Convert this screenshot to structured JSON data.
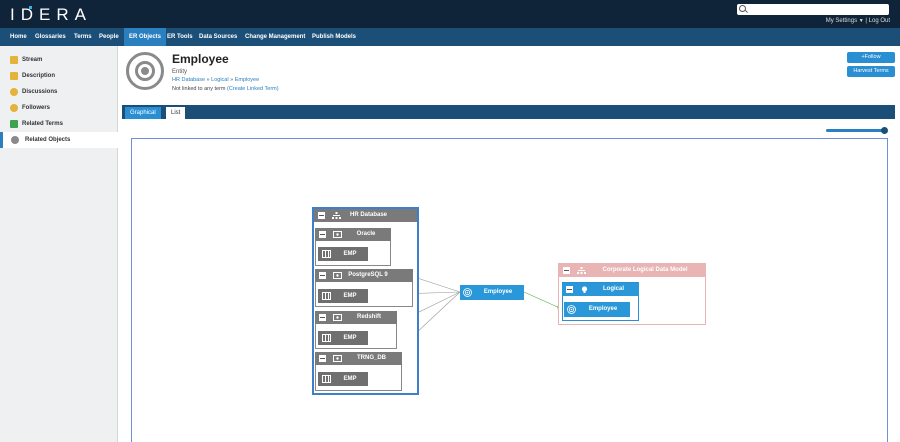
{
  "app": {
    "logo": "IDERA",
    "search_placeholder": "",
    "my_settings": "My Settings",
    "logout": "| Log Out"
  },
  "nav": [
    "Home",
    "Glossaries",
    "Terms",
    "People",
    "ER Objects",
    "ER Tools",
    "Data Sources",
    "Change Management",
    "Publish Models"
  ],
  "nav_active": "ER Objects",
  "sidebar": [
    {
      "label": "Stream",
      "icon": "stream-icon",
      "color": "#e3b33a"
    },
    {
      "label": "Description",
      "icon": "description-icon",
      "color": "#e3b33a"
    },
    {
      "label": "Discussions",
      "icon": "discussions-icon",
      "color": "#e3b33a"
    },
    {
      "label": "Followers",
      "icon": "followers-icon",
      "color": "#e3b33a"
    },
    {
      "label": "Related Terms",
      "icon": "related-terms-icon",
      "color": "#3fa34d"
    },
    {
      "label": "Related Objects",
      "icon": "related-objects-icon",
      "color": "#8a8a8a"
    }
  ],
  "sidebar_active": "Related Objects",
  "entity": {
    "title": "Employee",
    "type": "Entity",
    "breadcrumb": [
      "HR Database",
      "Logical",
      "Employee"
    ],
    "linked_text": "Not linked to any term",
    "linked_link": "(Create Linked Term)"
  },
  "buttons": {
    "follow": "+Follow",
    "harvest": "Harvest Terms"
  },
  "view_tabs": {
    "graphical": "Graphical",
    "list": "List"
  },
  "zoom": 1.0,
  "diagram": {
    "hr_database": "HR Database",
    "sources": [
      {
        "name": "Oracle",
        "table": "EMP"
      },
      {
        "name": "PostgreSQL 9",
        "table": "EMP"
      },
      {
        "name": "Redshift",
        "table": "EMP"
      },
      {
        "name": "TRNG_DB",
        "table": "EMP"
      }
    ],
    "center": "Employee",
    "corporate_model": "Corporate Logical Data Model",
    "logical": "Logical",
    "logical_entity": "Employee"
  },
  "colors": {
    "topbar": "#0f2438",
    "nav": "#1b4f77",
    "accent": "#2a8ed3",
    "node_header": "#7a7a7a",
    "corporate_border": "#e8b4b4",
    "hr_border": "#3d7fc9"
  }
}
